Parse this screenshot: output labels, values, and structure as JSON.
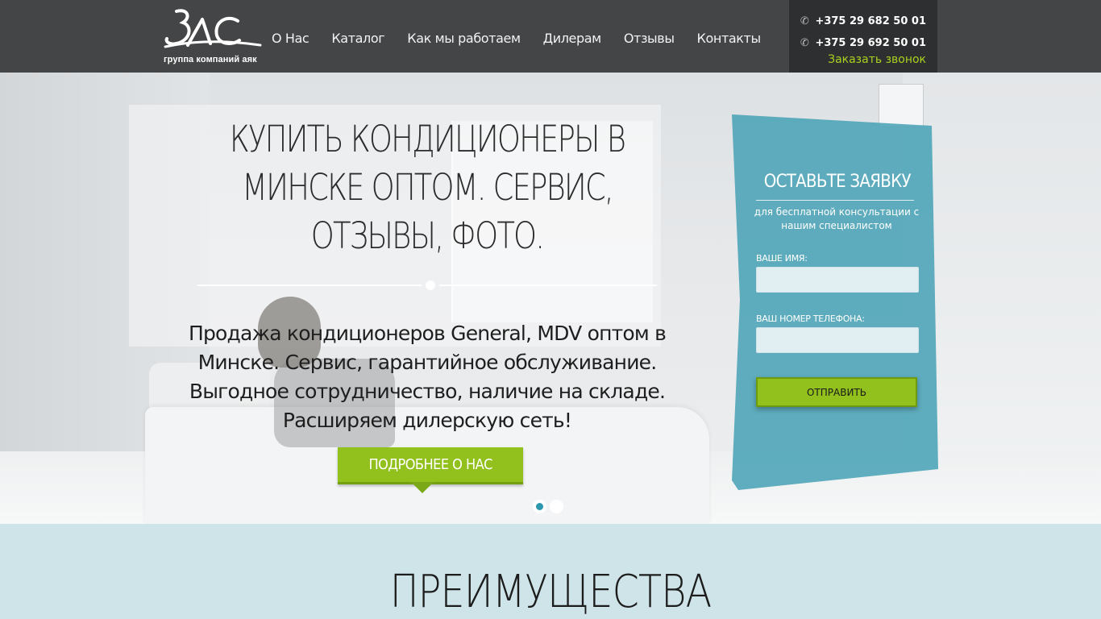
{
  "header": {
    "logo_text": "ЗАС",
    "logo_sub": "группа компаний аяк",
    "nav": [
      {
        "label": "О Нас"
      },
      {
        "label": "Каталог"
      },
      {
        "label": "Как мы работаем"
      },
      {
        "label": "Дилерам"
      },
      {
        "label": "Отзывы"
      },
      {
        "label": "Контакты"
      }
    ],
    "phone_icon": "phone-icon",
    "phones": [
      "+375 29 682 50 01",
      "+375 29 692 50 01"
    ],
    "callback_label": "Заказать звонок"
  },
  "hero": {
    "title": "КУПИТЬ КОНДИЦИОНЕРЫ В МИНСКЕ ОПТОМ. СЕРВИС, ОТЗЫВЫ, ФОТО.",
    "subtitle": "Продажа кондиционеров General, MDV оптом в Минске. Сервис, гарантийное обслуживание. Выгодное сотрудничество, наличие на складе. Расширяем дилерскую сеть!",
    "more_button": "ПОДРОБНЕЕ О НАС",
    "slides_count": 2,
    "active_slide": 1
  },
  "form": {
    "title": "ОСТАВЬТЕ ЗАЯВКУ",
    "description": "для бесплатной консультации с нашим специалистом",
    "name_label": "ВАШЕ ИМЯ:",
    "name_value": "",
    "phone_label": "ВАШ НОМЕР ТЕЛЕФОНА:",
    "phone_value": "",
    "submit_label": "ОТПРАВИТЬ"
  },
  "advantages": {
    "title": "ПРЕИМУЩЕСТВА"
  },
  "colors": {
    "header_bg": "#444546",
    "contacts_bg": "#2e2f30",
    "accent_green": "#92c11d",
    "form_teal": "#4aa3b6",
    "section_bg": "#cfe4e8"
  }
}
